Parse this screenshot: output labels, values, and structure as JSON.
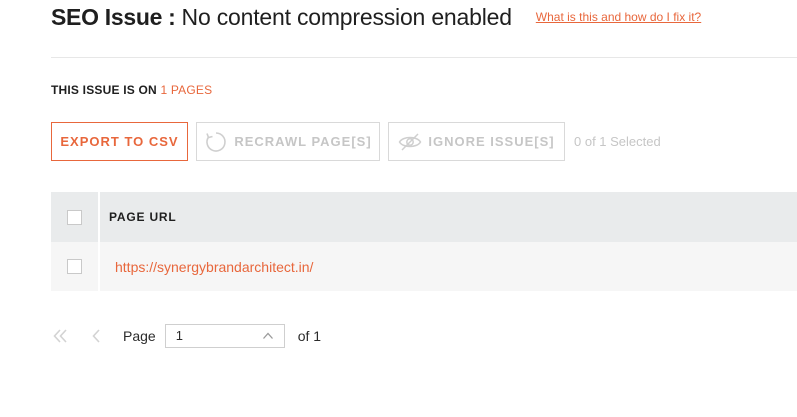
{
  "header": {
    "issue_key": "SEO Issue :",
    "issue_value": "No content compression enabled",
    "help_link": "What is this and how do I fix it?"
  },
  "issue_count": {
    "prefix": "THIS ISSUE IS ON",
    "count_text": "1 PAGES"
  },
  "toolbar": {
    "export_label": "EXPORT TO CSV",
    "recrawl_label": "RECRAWL PAGE[S]",
    "ignore_label": "IGNORE ISSUE[S]",
    "selected_text": "0 of 1 Selected"
  },
  "table": {
    "columns": [
      "PAGE URL"
    ],
    "rows": [
      {
        "url": "https://synergybrandarchitect.in/"
      }
    ]
  },
  "pagination": {
    "page_label": "Page",
    "current_page": "1",
    "of_label": "of 1"
  },
  "colors": {
    "accent": "#e8673c",
    "disabled": "#c6c6c6",
    "header_bg": "#e9ebec",
    "row_bg": "#f6f6f6"
  },
  "icons": {
    "recrawl": "refresh-icon",
    "ignore": "eye-off-icon",
    "first_page": "double-chevron-left-icon",
    "prev_page": "chevron-left-icon",
    "page_select": "chevron-up-icon"
  }
}
